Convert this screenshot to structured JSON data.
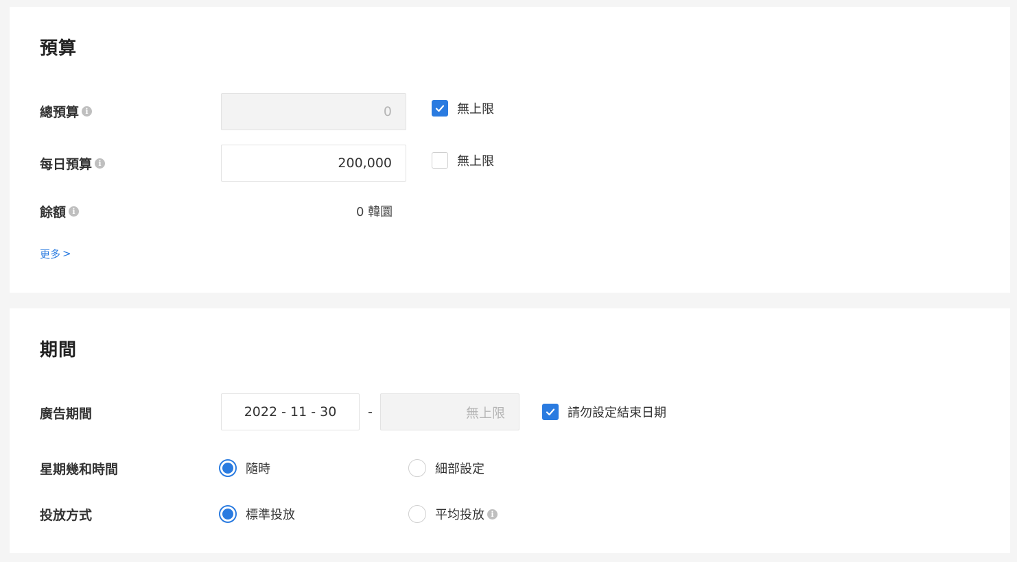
{
  "budget": {
    "title": "預算",
    "total_budget": {
      "label": "總預算",
      "value": "0",
      "unlimited_label": "無上限",
      "unlimited_checked": true
    },
    "daily_budget": {
      "label": "每日預算",
      "value": "200,000",
      "unlimited_label": "無上限",
      "unlimited_checked": false
    },
    "balance": {
      "label": "餘額",
      "value": "0 韓圜"
    },
    "more_link": "更多",
    "more_chevron": ">"
  },
  "period": {
    "title": "期間",
    "ad_period": {
      "label": "廣告期間",
      "start_date": "2022 - 11 - 30",
      "separator": "-",
      "end_date_placeholder": "無上限",
      "no_end_date_label": "請勿設定結束日期",
      "no_end_date_checked": true
    },
    "schedule": {
      "label": "星期幾和時間",
      "options": [
        {
          "label": "隨時",
          "checked": true
        },
        {
          "label": "細部設定",
          "checked": false
        }
      ]
    },
    "delivery": {
      "label": "投放方式",
      "options": [
        {
          "label": "標準投放",
          "checked": true
        },
        {
          "label": "平均投放",
          "checked": false
        }
      ]
    }
  },
  "icons": {
    "info": "i"
  },
  "colors": {
    "accent": "#2a7be0",
    "page_background": "#f5f5f5",
    "card_background": "#ffffff",
    "disabled_input": "#f3f3f3"
  }
}
